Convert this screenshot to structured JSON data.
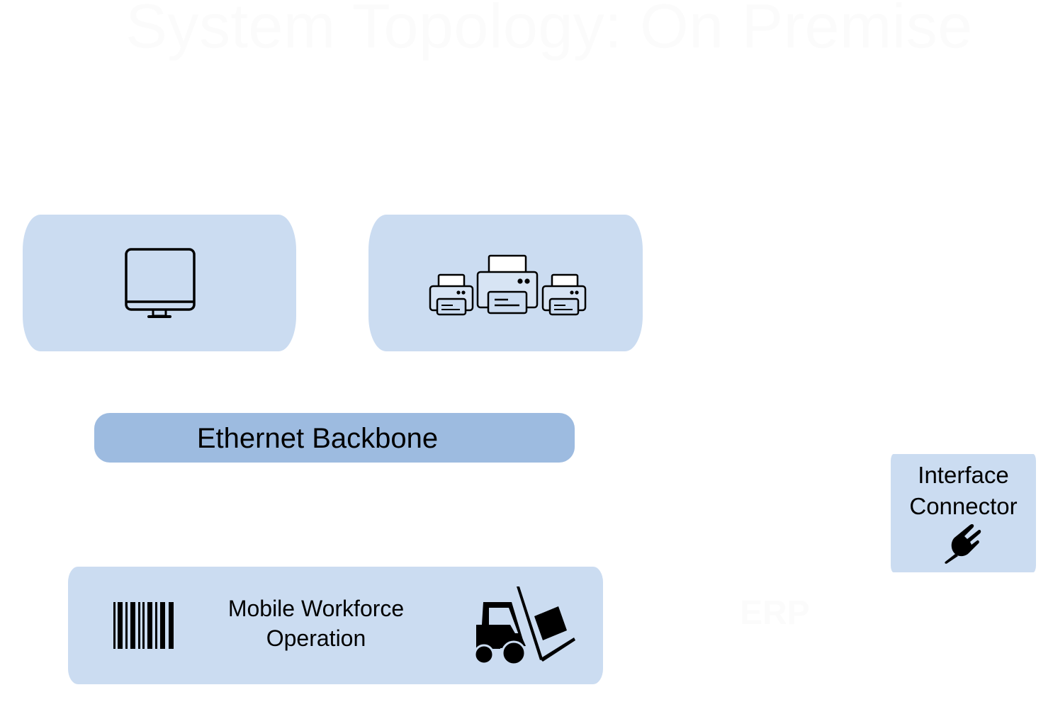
{
  "diagram": {
    "title": "System Topology: On Premise",
    "watermark_label": "ERP",
    "colors": {
      "node_fill": "#cbdcf1",
      "backbone_fill": "#9dbbe0",
      "icon_stroke": "#000000",
      "title_color": "#fbfbfb"
    },
    "nodes": {
      "workstation": {
        "icon": "monitor-icon"
      },
      "printers": {
        "icon": "printers-icon"
      },
      "backbone": {
        "label": "Ethernet Backbone"
      },
      "connector": {
        "label_line1": "Interface",
        "label_line2": "Connector",
        "icon": "plug-icon"
      },
      "mobile": {
        "label_line1": "Mobile Workforce",
        "label_line2": "Operation",
        "left_icon": "barcode-icon",
        "right_icon": "forklift-icon"
      }
    }
  }
}
